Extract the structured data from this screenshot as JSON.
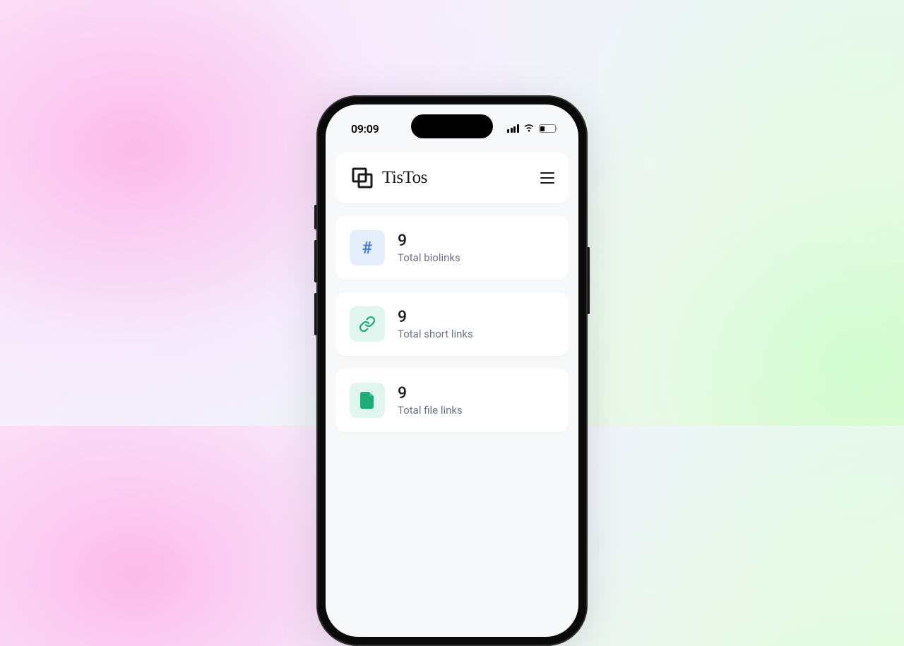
{
  "status_bar": {
    "time": "09:09"
  },
  "header": {
    "logo_text": "TisTos"
  },
  "stats": [
    {
      "icon_name": "hash-icon",
      "icon_color": "blue",
      "value": "9",
      "label": "Total biolinks"
    },
    {
      "icon_name": "link-icon",
      "icon_color": "green",
      "value": "9",
      "label": "Total short links"
    },
    {
      "icon_name": "file-icon",
      "icon_color": "green",
      "value": "9",
      "label": "Total file links"
    }
  ]
}
